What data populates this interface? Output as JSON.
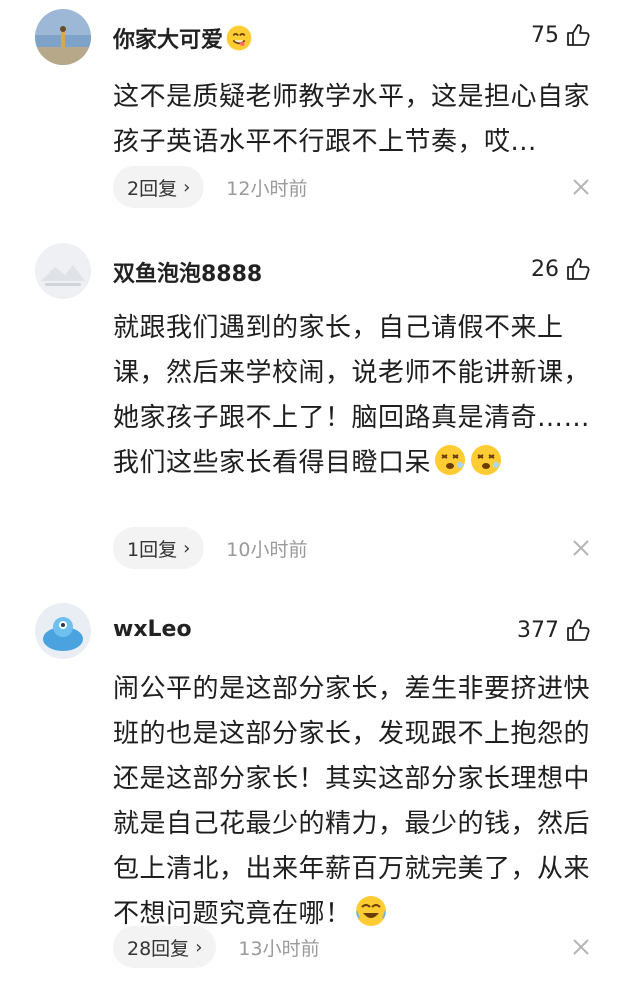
{
  "comments": [
    {
      "username": "你家大可爱",
      "username_emoji": "yum-face-icon",
      "likes": "75",
      "body": "这不是质疑老师教学水平，这是担心自家孩子英语水平不行跟不上节奏，哎...",
      "replies": "2回复",
      "time": "12小时前"
    },
    {
      "username": "双鱼泡泡8888",
      "likes": "26",
      "body": "就跟我们遇到的家长，自己请假不来上课，然后来学校闹，说老师不能讲新课，她家孩子跟不上了！脑回路真是清奇……我们这些家长看得目瞪口呆",
      "body_emoji": "dizzy-face-icon",
      "replies": "1回复",
      "time": "10小时前"
    },
    {
      "username": "wxLeo",
      "likes": "377",
      "body": "闹公平的是这部分家长，差生非要挤进快班的也是这部分家长，发现跟不上抱怨的还是这部分家长！其实这部分家长理想中就是自己花最少的精力，最少的钱，然后包上清北，出来年薪百万就完美了，从来不想问题究竟在哪！",
      "body_emoji": "crying-laughing-face-icon",
      "replies": "28回复",
      "time": "13小时前"
    }
  ],
  "colors": {
    "text": "#1e1e1e",
    "muted": "#9a9a9a",
    "pill_bg": "#f3f3f3"
  }
}
